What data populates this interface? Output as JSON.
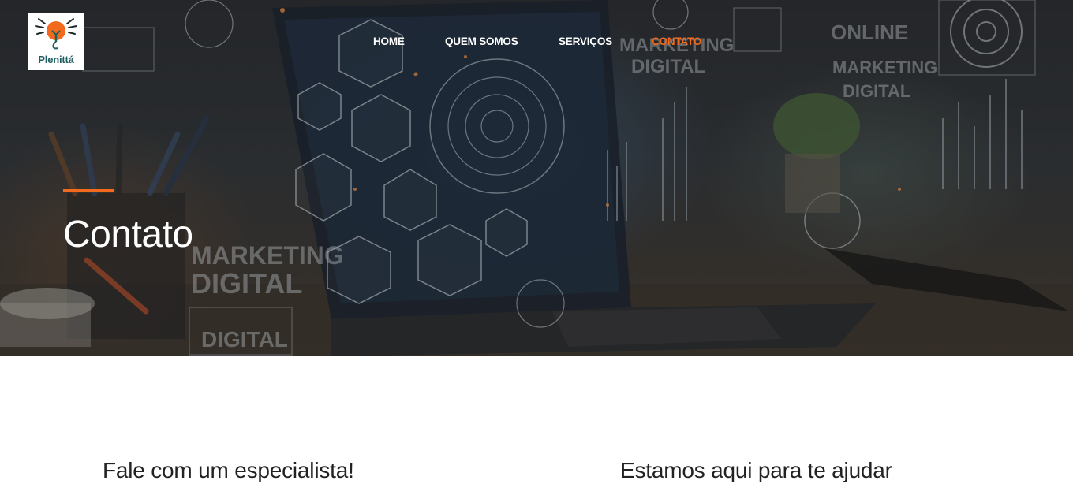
{
  "brand": {
    "logo_text": "Plenittá",
    "accent_color": "#f26a1b",
    "logo_text_color": "#1f5f61"
  },
  "nav": {
    "items": [
      {
        "label": "HOME"
      },
      {
        "label": "QUEM SOMOS"
      },
      {
        "label": "SERVIÇOS"
      },
      {
        "label": "CONTATO",
        "active": true
      }
    ]
  },
  "hero": {
    "title": "Contato",
    "background_words": [
      "MARKETING",
      "DIGITAL",
      "ONLINE",
      "MARKETING",
      "DIGITAL",
      "MARKETING",
      "DIGITAL",
      "DIGITAL"
    ]
  },
  "content": {
    "left_heading": "Fale com um especialista!",
    "right_heading": "Estamos aqui para te ajudar"
  }
}
